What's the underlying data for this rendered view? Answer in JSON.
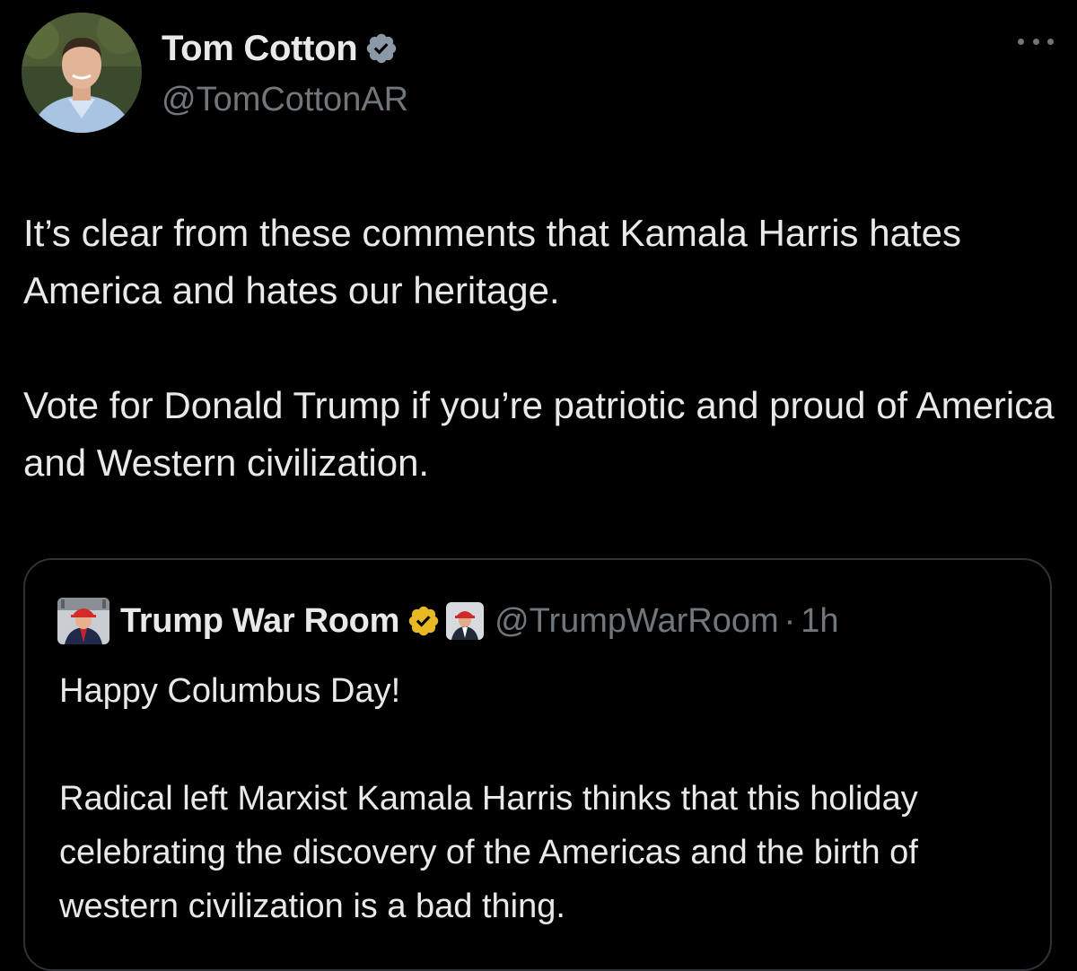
{
  "tweet": {
    "author": {
      "display_name": "Tom Cotton",
      "handle": "@TomCottonAR",
      "verified_icon": "verified-badge-icon",
      "verified_color": "#8b98a5"
    },
    "more_icon": "more-options-icon",
    "paragraphs": [
      "It’s clear from these comments that Kamala Harris hates America and hates our heritage.",
      "Vote for Donald Trump if you’re patriotic and proud of America and Western civilization."
    ]
  },
  "quoted_tweet": {
    "author": {
      "display_name": "Trump War Room",
      "handle": "@TrumpWarRoom",
      "verified_icon": "gold-verified-badge-icon",
      "verified_color": "#e8b923"
    },
    "separator": "·",
    "time": "1h",
    "paragraphs": [
      "Happy Columbus Day!",
      "Radical left Marxist Kamala Harris thinks that this holiday celebrating the discovery of the Americas and the birth of western civilization is a bad thing."
    ]
  },
  "colors": {
    "background": "#000000",
    "primary_text": "#e7e9ea",
    "secondary_text": "#71767b",
    "border": "#2f3336"
  }
}
